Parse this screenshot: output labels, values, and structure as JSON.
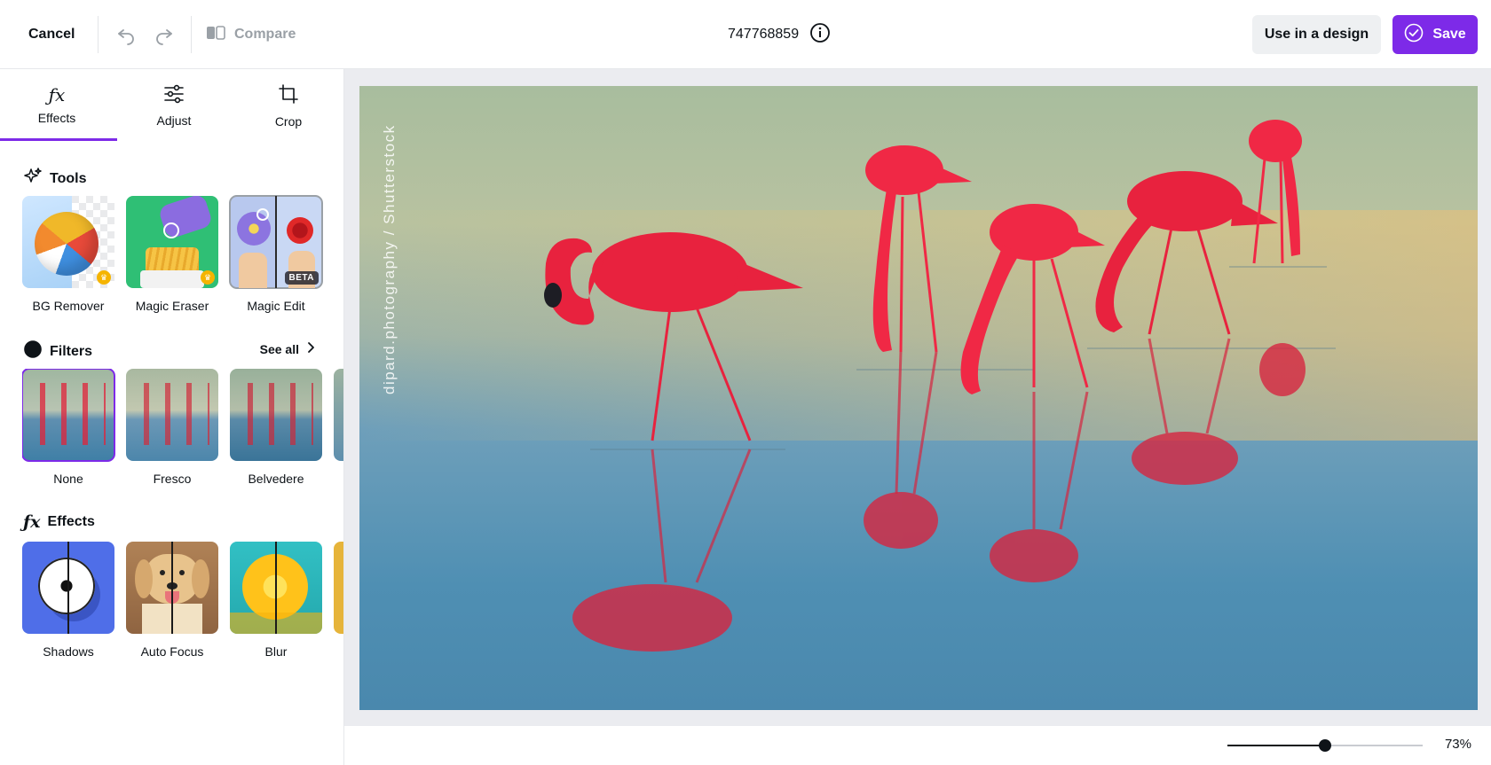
{
  "header": {
    "cancel_label": "Cancel",
    "compare_label": "Compare",
    "title": "747768859",
    "use_in_design_label": "Use in a design",
    "save_label": "Save"
  },
  "tabs": [
    {
      "label": "Effects",
      "icon": "fx-icon",
      "active": true
    },
    {
      "label": "Adjust",
      "icon": "sliders-icon",
      "active": false
    },
    {
      "label": "Crop",
      "icon": "crop-icon",
      "active": false
    }
  ],
  "tools": {
    "heading": "Tools",
    "items": [
      {
        "label": "BG Remover",
        "badge": "crown"
      },
      {
        "label": "Magic Eraser",
        "badge": "crown"
      },
      {
        "label": "Magic Edit",
        "badge": "BETA"
      }
    ]
  },
  "filters": {
    "heading": "Filters",
    "see_all_label": "See all",
    "items": [
      {
        "label": "None",
        "selected": true
      },
      {
        "label": "Fresco",
        "selected": false
      },
      {
        "label": "Belvedere",
        "selected": false
      }
    ]
  },
  "effects": {
    "heading": "Effects",
    "items": [
      {
        "label": "Shadows"
      },
      {
        "label": "Auto Focus"
      },
      {
        "label": "Blur"
      }
    ]
  },
  "canvas": {
    "credit": "dipard.photography / Shutterstock"
  },
  "zoom": {
    "value_label": "73%",
    "level": 0.5
  },
  "colors": {
    "accent": "#7d2ae8",
    "canvas_bg": "#ebecf0"
  }
}
